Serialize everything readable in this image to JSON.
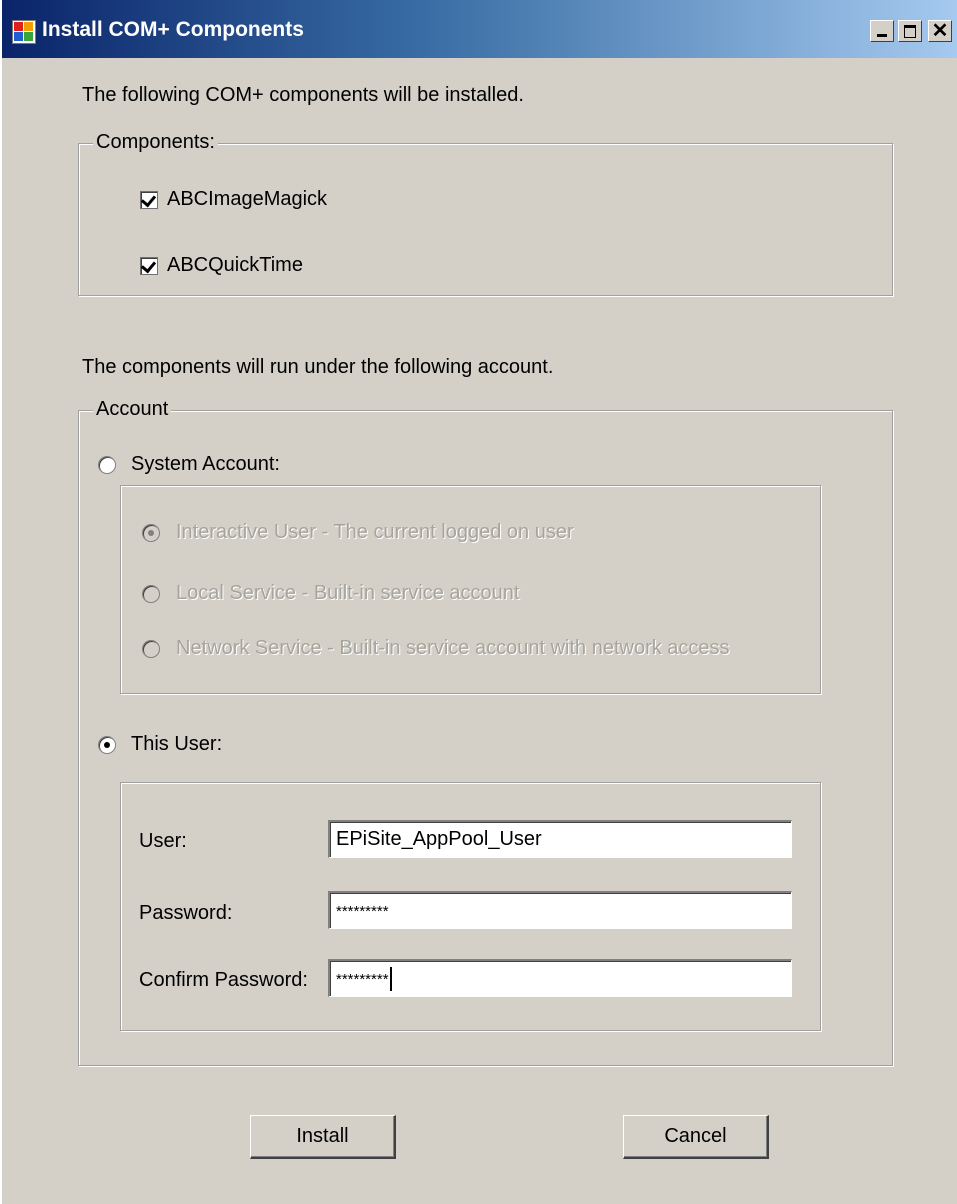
{
  "window": {
    "title": "Install COM+ Components",
    "controls": {
      "minimize": "_",
      "maximize": "□",
      "close": "✕"
    }
  },
  "intro_text": "The following COM+ components will be installed.",
  "components": {
    "legend": "Components:",
    "items": [
      {
        "label": "ABCImageMagick",
        "checked": true
      },
      {
        "label": "ABCQuickTime",
        "checked": true
      }
    ]
  },
  "account_intro": "The components will run under the following account.",
  "account": {
    "legend": "Account",
    "system_account": {
      "label": "System Account:",
      "selected": false,
      "options": [
        {
          "label": "Interactive User - The current logged on user",
          "selected": true,
          "enabled": false
        },
        {
          "label": "Local Service - Built-in service account",
          "selected": false,
          "enabled": false
        },
        {
          "label": "Network Service - Built-in service account with network access",
          "selected": false,
          "enabled": false
        }
      ]
    },
    "this_user": {
      "label": "This User:",
      "selected": true,
      "fields": {
        "user_label": "User:",
        "user_value": "EPiSite_AppPool_User",
        "password_label": "Password:",
        "password_value": "*********",
        "confirm_label": "Confirm Password:",
        "confirm_value": "*********"
      }
    }
  },
  "buttons": {
    "install": "Install",
    "cancel": "Cancel"
  }
}
